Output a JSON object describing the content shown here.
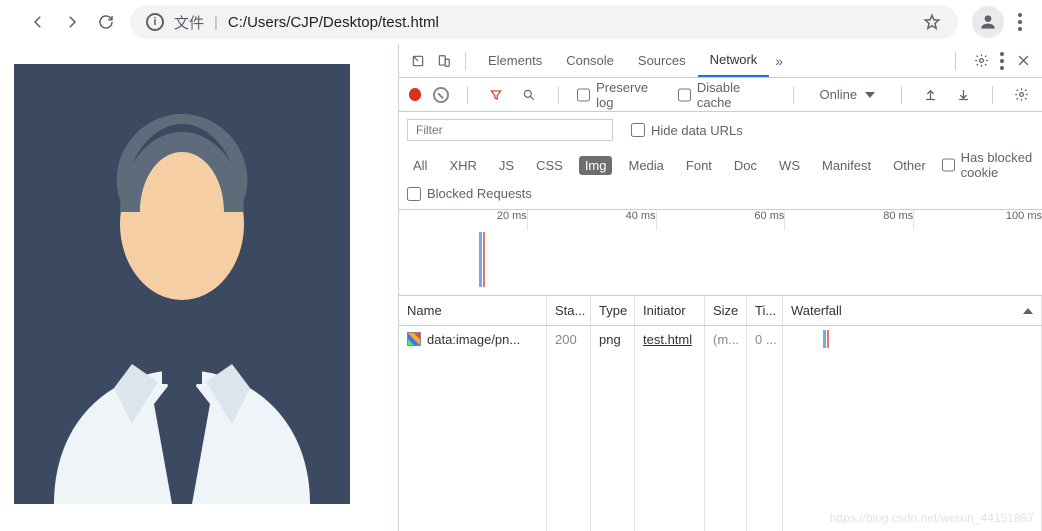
{
  "toolbar": {
    "file_label": "文件",
    "url": "C:/Users/CJP/Desktop/test.html"
  },
  "devtools": {
    "tabs": [
      "Elements",
      "Console",
      "Sources",
      "Network"
    ],
    "active_tab": "Network",
    "network_toolbar": {
      "preserve_log": "Preserve log",
      "disable_cache": "Disable cache",
      "throttling": "Online"
    },
    "filter": {
      "placeholder": "Filter",
      "hide_data_urls": "Hide data URLs",
      "types": [
        "All",
        "XHR",
        "JS",
        "CSS",
        "Img",
        "Media",
        "Font",
        "Doc",
        "WS",
        "Manifest",
        "Other"
      ],
      "active_type": "Img",
      "has_blocked": "Has blocked cookie",
      "blocked_requests": "Blocked Requests"
    },
    "overview_ticks": [
      "20 ms",
      "40 ms",
      "60 ms",
      "80 ms",
      "100 ms"
    ],
    "columns": {
      "name": "Name",
      "status": "Sta...",
      "type": "Type",
      "initiator": "Initiator",
      "size": "Size",
      "time": "Ti...",
      "waterfall": "Waterfall"
    },
    "rows": [
      {
        "name": "data:image/pn...",
        "status": "200",
        "type": "png",
        "initiator": "test.html",
        "size": "(m...",
        "time": "0 ..."
      }
    ]
  },
  "watermark": "https://blog.csdn.net/weixin_44151887"
}
